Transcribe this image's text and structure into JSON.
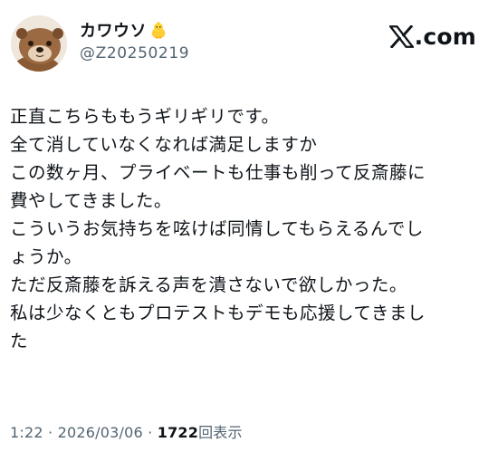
{
  "author": {
    "display_name": "カワウソ",
    "handle": "@Z20250219",
    "avatar_icon": "otter-avatar",
    "badge_icon": "baby-chick-emoji"
  },
  "brand": {
    "logo_icon": "x-logo-icon",
    "text": ".com"
  },
  "tweet": {
    "lines": [
      "正直こちらももうギリギリです。",
      "全て消していなくなれば満足しますか",
      "この数ヶ月、プライベートも仕事も削って反斎藤に",
      "費やしてきました。",
      "こういうお気持ちを呟けば同情してもらえるんでし",
      "ょうか。",
      "ただ反斎藤を訴える声を潰さないで欲しかった。",
      "私は少なくともプロテストもデモも応援してきまし",
      "た"
    ]
  },
  "meta": {
    "time": "1:22",
    "separator": "·",
    "date": "2026/03/06",
    "views_count": "1722",
    "views_label": "回表示"
  }
}
